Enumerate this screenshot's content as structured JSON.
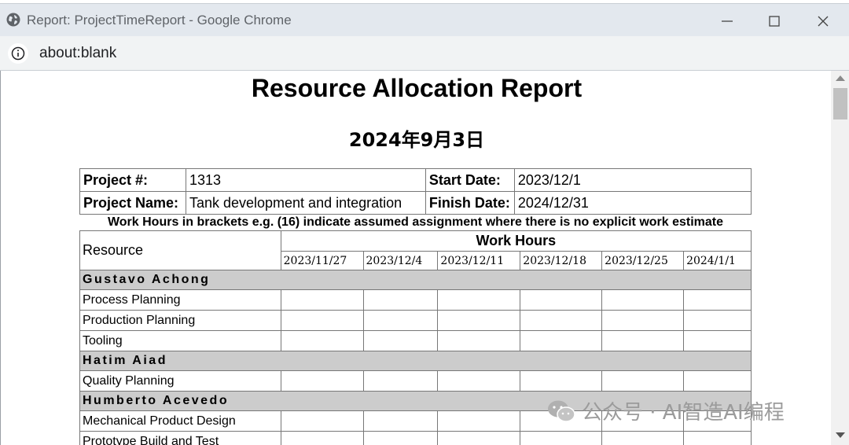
{
  "window": {
    "title": "Report: ProjectTimeReport - Google Chrome",
    "url": "about:blank"
  },
  "report": {
    "title": "Resource Allocation Report",
    "date": "2024年9月3日",
    "project_number_label": "Project #:",
    "project_number": "1313",
    "project_name_label": "Project Name:",
    "project_name": "Tank development and integration",
    "start_date_label": "Start Date:",
    "start_date": "2023/12/1",
    "finish_date_label": "Finish Date:",
    "finish_date": "2024/12/31",
    "note": "Work Hours in brackets e.g. (16) indicate assumed assignment where there is no explicit work estimate"
  },
  "grid": {
    "resource_header": "Resource",
    "work_hours_header": "Work Hours",
    "weeks": [
      "2023/11/27",
      "2023/12/4",
      "2023/12/11",
      "2023/12/18",
      "2023/12/25",
      "2024/1/1"
    ],
    "people": [
      {
        "name": "Gustavo Achong",
        "tasks": [
          "Process Planning",
          "Production Planning",
          "Tooling"
        ]
      },
      {
        "name": "Hatim Aiad",
        "tasks": [
          "Quality Planning"
        ]
      },
      {
        "name": "Humberto Acevedo",
        "tasks": [
          "Mechanical Product Design",
          "Prototype Build and Test"
        ]
      }
    ]
  },
  "watermark": {
    "text": "公众号 · AI智造AI编程"
  }
}
